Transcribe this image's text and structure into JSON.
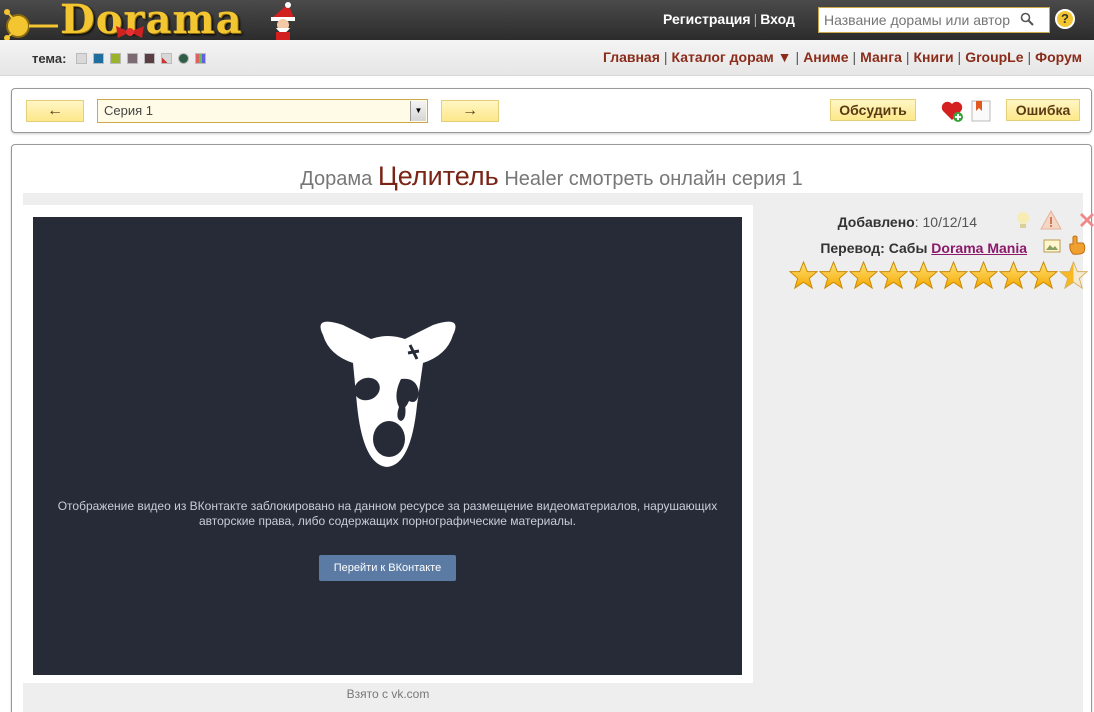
{
  "header": {
    "logo_text": "Dorama",
    "auth": {
      "register": "Регистрация",
      "login": "Вход"
    },
    "search_placeholder": "Название дорамы или автор"
  },
  "navbar": {
    "theme_label": "тема:",
    "theme_swatches": [
      "#d9d9d9",
      "#1e6fa0",
      "#9bb32a",
      "#7d6b73",
      "#5b3d44",
      "#d8d8d8",
      "#2f5e48",
      "#e8e0c0"
    ],
    "menu": [
      {
        "label": "Главная"
      },
      {
        "label": "Каталог дорам ▼"
      },
      {
        "label": "Аниме"
      },
      {
        "label": "Манга"
      },
      {
        "label": "Книги"
      },
      {
        "label": "GroupLe"
      },
      {
        "label": "Форум"
      }
    ]
  },
  "episode_bar": {
    "prev_label": "←",
    "next_label": "→",
    "selected_episode": "Серия 1",
    "discuss_label": "Обсудить",
    "error_label": "Ошибка"
  },
  "page": {
    "title_prefix": "Дорама",
    "title_main": "Целитель",
    "title_suffix": "Healer смотреть онлайн серия 1"
  },
  "player": {
    "blocked_message": "Отображение видео из ВКонтакте заблокировано на данном ресурсе за размещение видеоматериалов, нарушающих авторские права, либо содержащих порнографические материалы.",
    "button_label": "Перейти к ВКонтакте",
    "source": "Взято с vk.com"
  },
  "info": {
    "added_label": "Добавлено",
    "added_date": ": 10/12/14",
    "translation_label": "Перевод: Сабы",
    "translation_group": "Dorama Mania",
    "rating_stars_filled": 9.5,
    "rating_stars_total": 10
  },
  "colors": {
    "accent_red": "#8b2c1a",
    "button_yellow": "#fde88a",
    "player_bg": "#272b38",
    "vk_blue": "#5b7ba4"
  }
}
